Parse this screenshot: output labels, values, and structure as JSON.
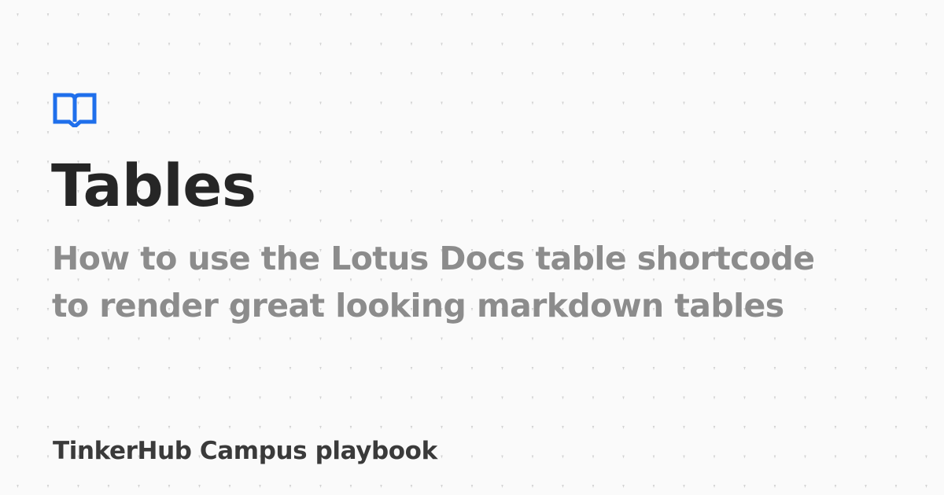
{
  "card": {
    "title": "Tables",
    "subtitle_lines": [
      "How to use the Lotus Docs table shortcode",
      "to render great looking markdown tables"
    ],
    "site_name": "TinkerHub Campus playbook",
    "logo_icon": "book-open-icon"
  },
  "colors": {
    "background": "#fafafa",
    "dot": "#d2d2d2",
    "accent": "#1f6feb",
    "title": "#262626",
    "subtitle": "#8c8c8c",
    "site_name": "#3a3a3a"
  }
}
